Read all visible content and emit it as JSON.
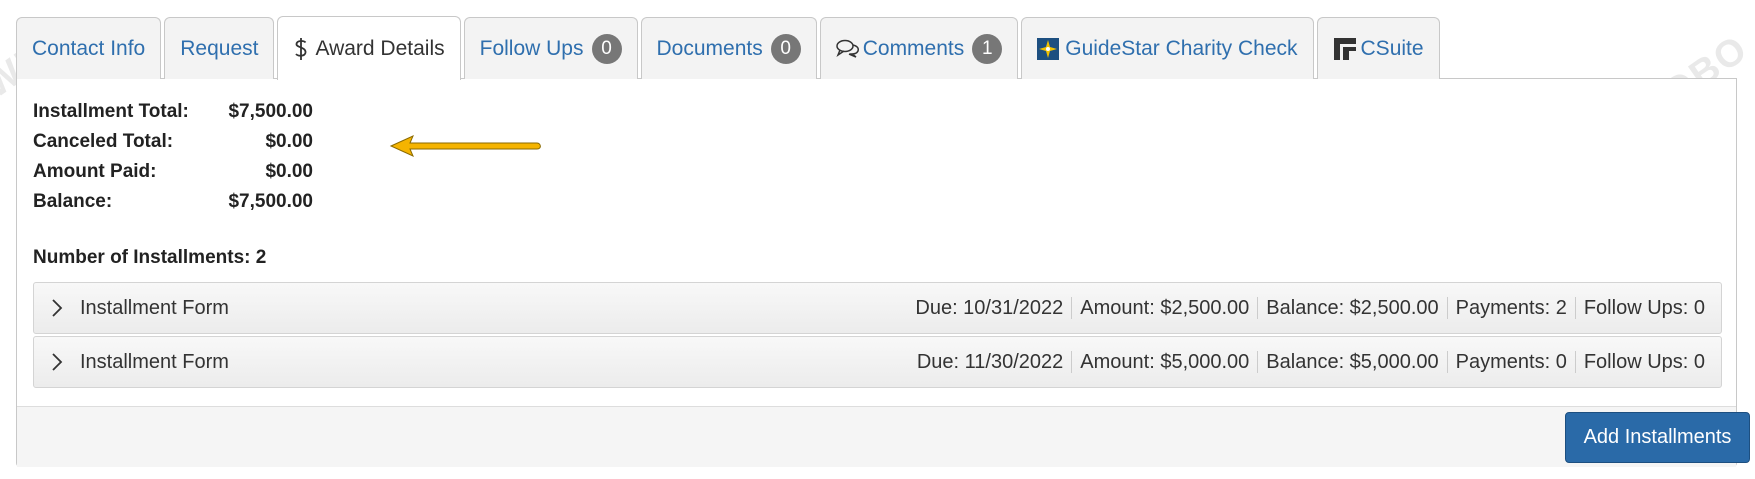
{
  "tabs": [
    {
      "label": "Contact Info"
    },
    {
      "label": "Request"
    },
    {
      "label": "Award Details",
      "icon": "dollar-icon",
      "active": true
    },
    {
      "label": "Follow Ups",
      "badge": "0"
    },
    {
      "label": "Documents",
      "badge": "0"
    },
    {
      "label": "Comments",
      "icon": "comments-icon",
      "badge": "1"
    },
    {
      "label": "GuideStar Charity Check",
      "icon": "guidestar-logo-icon"
    },
    {
      "label": "CSuite",
      "icon": "csuite-logo-icon"
    }
  ],
  "totals": [
    {
      "label": "Installment Total:",
      "value": "$7,500.00"
    },
    {
      "label": "Canceled Total:",
      "value": "$0.00"
    },
    {
      "label": "Amount Paid:",
      "value": "$0.00"
    },
    {
      "label": "Balance:",
      "value": "$7,500.00"
    }
  ],
  "num_installments": "Number of Installments: 2",
  "installments": [
    {
      "title": "Installment Form",
      "due": "Due: 10/31/2022",
      "amount": "Amount: $2,500.00",
      "balance": "Balance: $2,500.00",
      "payments": "Payments: 2",
      "followups": "Follow Ups: 0"
    },
    {
      "title": "Installment Form",
      "due": "Due: 11/30/2022",
      "amount": "Amount: $5,000.00",
      "balance": "Balance: $5,000.00",
      "payments": "Payments: 0",
      "followups": "Follow Ups: 0"
    }
  ],
  "add_button": "Add Installments",
  "colors": {
    "link": "#2f6fae",
    "badge": "#777777",
    "button": "#2a6aa8",
    "arrow": "#f5b400"
  }
}
